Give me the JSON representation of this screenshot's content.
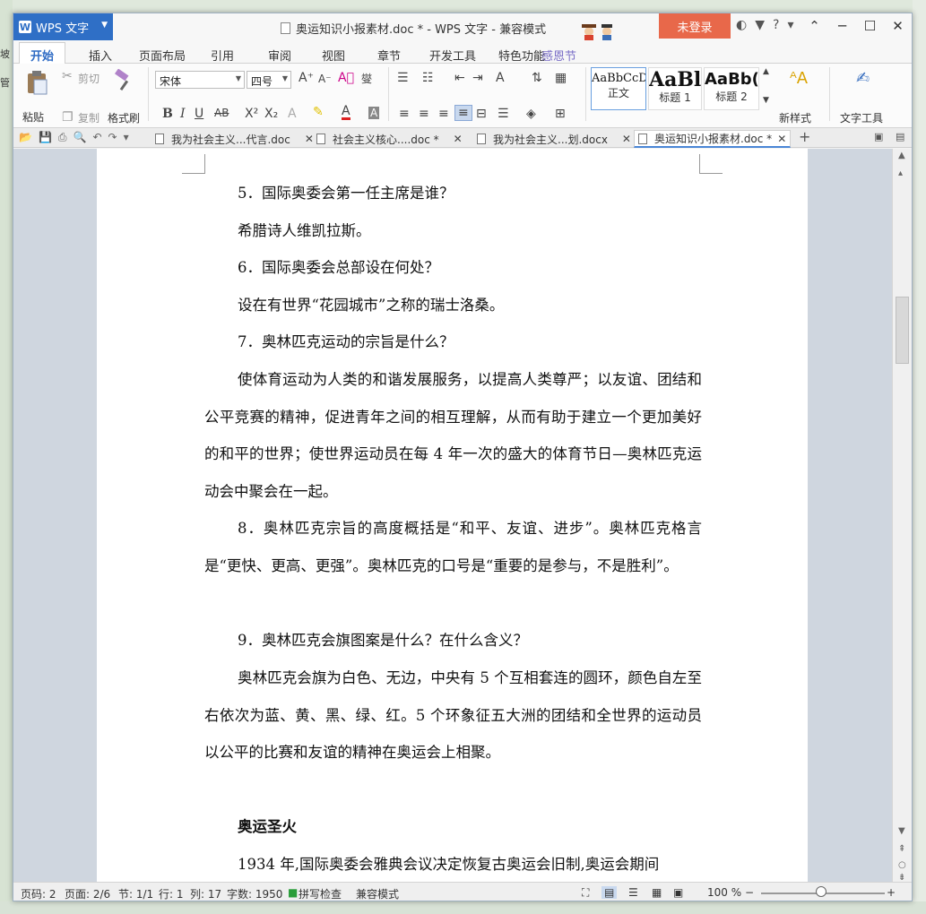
{
  "desktop": {
    "left_labels": [
      "坡",
      "管"
    ]
  },
  "titlebar": {
    "app_name": "WPS 文字",
    "logo_letter": "W",
    "title": "奥运知识小报素材.doc * - WPS 文字 - 兼容模式",
    "login": "未登录"
  },
  "menu": {
    "tabs": [
      "开始",
      "插入",
      "页面布局",
      "引用",
      "审阅",
      "视图",
      "章节",
      "开发工具",
      "特色功能",
      "感恩节"
    ]
  },
  "ribbon": {
    "paste": "粘贴",
    "cut": "剪切",
    "copy": "复制",
    "format_painter": "格式刷",
    "font_name": "宋体",
    "font_size": "四号",
    "styles": [
      {
        "sample": "AaBbCcD",
        "name": "正文"
      },
      {
        "sample": "AaBl",
        "name": "标题 1"
      },
      {
        "sample": "AaBb(",
        "name": "标题 2"
      }
    ],
    "new_style": "新样式",
    "text_tools": "文字工具"
  },
  "doc_tabs": [
    {
      "label": "我为社会主义...代言.doc"
    },
    {
      "label": "社会主义核心....doc *"
    },
    {
      "label": "我为社会主义...划.docx"
    },
    {
      "label": "奥运知识小报素材.doc *"
    }
  ],
  "document": {
    "paragraphs": [
      "5．国际奥委会第一任主席是谁？",
      "希腊诗人维凯拉斯。",
      "6．国际奥委会总部设在何处？",
      "设在有世界“花园城市”之称的瑞士洛桑。",
      "7．奥林匹克运动的宗旨是什么？",
      "使体育运动为人类的和谐发展服务，以提高人类尊严；以友谊、团结和公平竞赛的精神，促进青年之间的相互理解，从而有助于建立一个更加美好的和平的世界；使世界运动员在每 4 年一次的盛大的体育节日—奥林匹克运动会中聚会在一起。",
      "8．奥林匹克宗旨的高度概括是“和平、友谊、进步”。奥林匹克格言是“更快、更高、更强”。奥林匹克的口号是“重要的是参与，不是胜利”。",
      "9．奥林匹克会旗图案是什么？在什么含义？",
      "奥林匹克会旗为白色、无边，中央有 5 个互相套连的圆环，颜色自左至右依次为蓝、黄、黑、绿、红。5 个环象征五大洲的团结和全世界的运动员以公平的比赛和友谊的精神在奥运会上相聚。",
      "奥运圣火",
      "1934 年,国际奥委会雅典会议决定恢复古奥运会旧制,奥运会期间"
    ]
  },
  "statusbar": {
    "page_num": "页码: 2",
    "pages": "页面: 2/6",
    "section": "节: 1/1",
    "row": "行: 1",
    "col": "列: 17",
    "word_count": "字数: 1950",
    "spell_check": "拼写检查",
    "mode": "兼容模式",
    "zoom": "100 %"
  },
  "colors": {
    "accent": "#2f6fc6",
    "login": "#e8684a"
  }
}
